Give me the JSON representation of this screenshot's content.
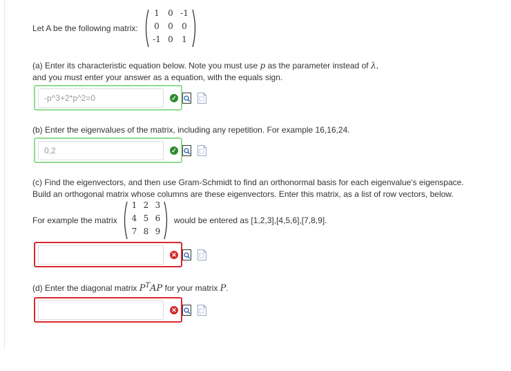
{
  "matrix_A": {
    "prefix": "Let A be the following matrix:",
    "rows": [
      [
        "1",
        "0",
        "-1"
      ],
      [
        "0",
        "0",
        "0"
      ],
      [
        "-1",
        "0",
        "1"
      ]
    ]
  },
  "part_a": {
    "line1_pre": "(a) Enter its characteristic equation below. Note you must use ",
    "param": "p",
    "line1_mid": " as the parameter instead of ",
    "lambda": "λ",
    "line1_end": ",",
    "line2": "and you must enter your answer as a equation, with the equals sign.",
    "value": "-p^3+2*p^2=0",
    "status": "correct"
  },
  "part_b": {
    "text": "(b) Enter the eigenvalues of the matrix, including any repetition. For example 16,16,24.",
    "value": "0,2",
    "status": "correct"
  },
  "part_c": {
    "line1": "(c) Find the eigenvectors, and then use Gram-Schmidt to find an orthonormal basis for each eigenvalue's eigenspace.",
    "line2": "Build an orthogonal matrix whose columns are these eigenvectors. Enter this matrix, as a list of row vectors, below.",
    "example_prefix": "For example the matrix",
    "example_rows": [
      [
        "1",
        "2",
        "3"
      ],
      [
        "4",
        "5",
        "6"
      ],
      [
        "7",
        "8",
        "9"
      ]
    ],
    "example_suffix": "would be entered as [1,2,3],[4,5,6],[7,8,9].",
    "value": "",
    "status": "incorrect"
  },
  "part_d": {
    "pre": "(d) Enter the diagonal matrix ",
    "P": "P",
    "T": "T",
    "AP": "AP",
    "mid": " for your matrix ",
    "P2": "P",
    "end": ".",
    "value": "",
    "status": "incorrect"
  },
  "icons": {
    "correct": "check-icon",
    "incorrect": "x-icon",
    "preview": "preview-icon",
    "document": "document-icon"
  },
  "colors": {
    "correct_border": "#8fdc8f",
    "incorrect_border": "#d9282f",
    "correct_badge": "#2e8b2e",
    "incorrect_badge": "#d32a2a"
  }
}
